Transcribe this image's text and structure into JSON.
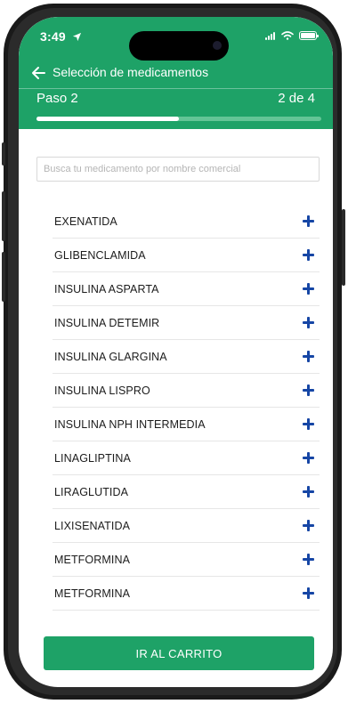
{
  "status_bar": {
    "time": "3:49"
  },
  "nav": {
    "title": "Selección de medicamentos"
  },
  "step": {
    "label": "Paso 2",
    "count": "2 de 4",
    "progress": 0.5
  },
  "search": {
    "placeholder": "Busca tu medicamento por nombre comercial",
    "value": ""
  },
  "medications": [
    {
      "name": "EXENATIDA"
    },
    {
      "name": "GLIBENCLAMIDA"
    },
    {
      "name": "INSULINA ASPARTA"
    },
    {
      "name": "INSULINA DETEMIR"
    },
    {
      "name": "INSULINA GLARGINA"
    },
    {
      "name": "INSULINA LISPRO"
    },
    {
      "name": "INSULINA NPH INTERMEDIA"
    },
    {
      "name": "LINAGLIPTINA"
    },
    {
      "name": "LIRAGLUTIDA"
    },
    {
      "name": "LIXISENATIDA"
    },
    {
      "name": "METFORMINA"
    },
    {
      "name": "METFORMINA"
    }
  ],
  "cart_button": {
    "label": "IR AL CARRITO"
  },
  "colors": {
    "primary": "#1ea267",
    "plus_icon": "#1646a5",
    "progress_track": "#63c596"
  },
  "icons": {
    "back": "arrow-left-icon",
    "add": "plus-icon",
    "location": "location-arrow-icon"
  }
}
